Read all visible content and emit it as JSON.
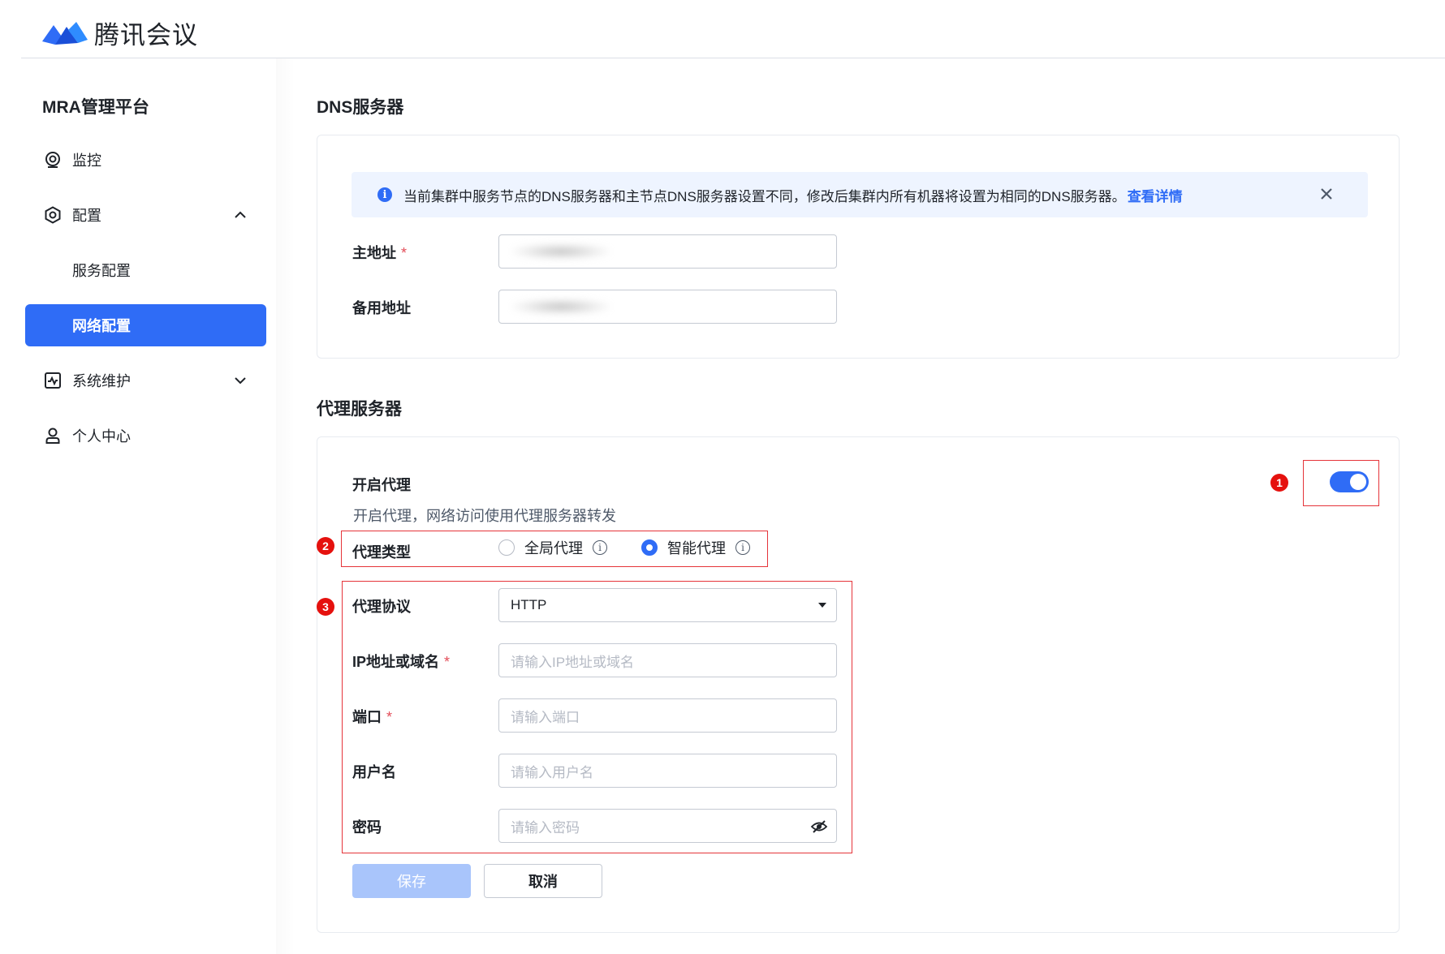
{
  "app": {
    "title": "腾讯会议"
  },
  "sidebar": {
    "platform_title": "MRA管理平台",
    "items": [
      {
        "label": "监控",
        "icon": "monitor-icon"
      },
      {
        "label": "配置",
        "icon": "settings-icon",
        "expanded": true
      },
      {
        "label": "服务配置"
      },
      {
        "label": "网络配置",
        "active": true
      },
      {
        "label": "系统维护",
        "icon": "system-maintenance-icon",
        "expanded": false
      },
      {
        "label": "个人中心",
        "icon": "user-icon"
      }
    ]
  },
  "dns": {
    "section_title": "DNS服务器",
    "alert": {
      "message": "当前集群中服务节点的DNS服务器和主节点DNS服务器设置不同，修改后集群内所有机器将设置为相同的DNS服务器。",
      "link": "查看详情"
    },
    "primary_label": "主地址",
    "primary_required": "*",
    "backup_label": "备用地址"
  },
  "proxy": {
    "section_title": "代理服务器",
    "enable_label": "开启代理",
    "enable_desc": "开启代理，网络访问使用代理服务器转发",
    "enabled": true,
    "type_label": "代理类型",
    "type_options": [
      {
        "label": "全局代理",
        "selected": false
      },
      {
        "label": "智能代理",
        "selected": true
      }
    ],
    "protocol_label": "代理协议",
    "protocol_value": "HTTP",
    "host_label": "IP地址或域名",
    "host_required": "*",
    "host_placeholder": "请输入IP地址或域名",
    "port_label": "端口",
    "port_required": "*",
    "port_placeholder": "请输入端口",
    "username_label": "用户名",
    "username_placeholder": "请输入用户名",
    "password_label": "密码",
    "password_placeholder": "请输入密码",
    "save_label": "保存",
    "cancel_label": "取消"
  },
  "annotations": {
    "badge1": "1",
    "badge2": "2",
    "badge3": "3"
  },
  "colors": {
    "accent": "#2f6cf6",
    "annotation_red": "#e5110e"
  }
}
